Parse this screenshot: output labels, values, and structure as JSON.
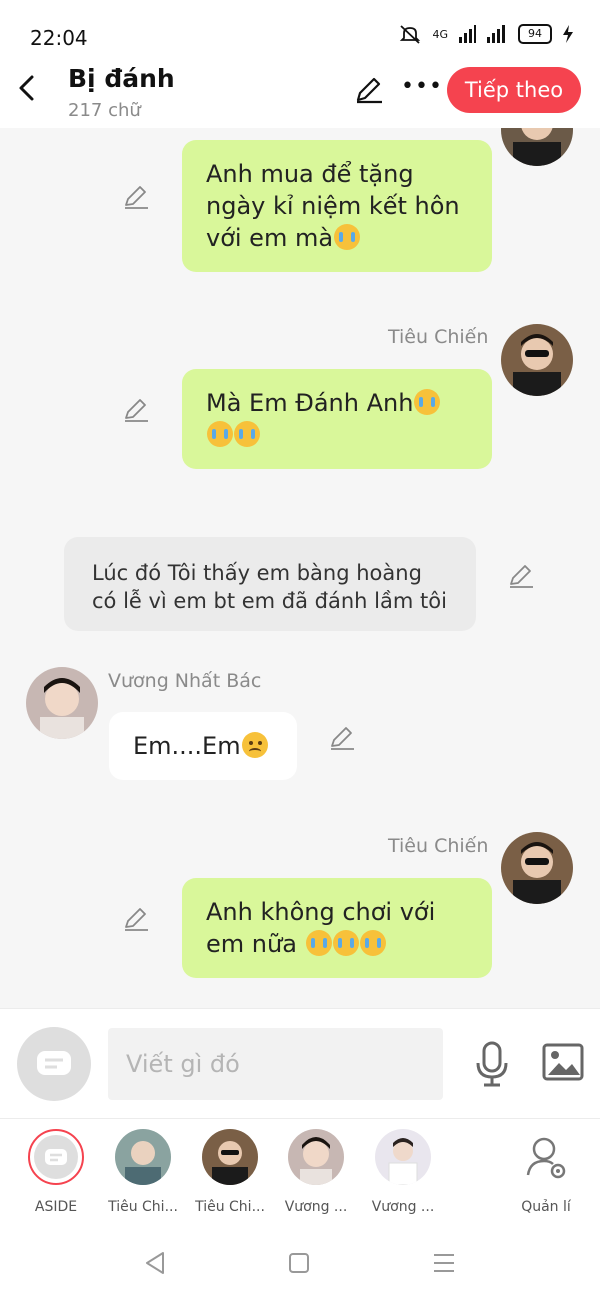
{
  "status": {
    "time": "22:04",
    "network": "4G",
    "battery": "94"
  },
  "header": {
    "title": "Bị đánh",
    "subtitle": "217 chữ",
    "next_label": "Tiếp theo"
  },
  "messages": {
    "m1": {
      "text": "Anh mua để tặng ngày kỉ niệm kết hôn với em mà"
    },
    "m2": {
      "speaker": "Tiêu Chiến",
      "line1": "Mà Em Đánh Anh"
    },
    "narration": {
      "text": "Lúc đó Tôi thấy em bàng hoàng có lễ vì em bt em đã đánh lầm tôi"
    },
    "m3": {
      "speaker": "Vương Nhất Bác",
      "text": "Em....Em"
    },
    "m4": {
      "speaker": "Tiêu Chiến",
      "text": "Anh không chơi với em nữa"
    }
  },
  "input": {
    "placeholder": "Viết gì đó"
  },
  "characters": [
    {
      "label": "ASIDE"
    },
    {
      "label": "Tiêu Chi..."
    },
    {
      "label": "Tiêu Chi..."
    },
    {
      "label": "Vương ..."
    },
    {
      "label": "Vương ..."
    },
    {
      "label": "Quản lí"
    }
  ],
  "colors": {
    "accent": "#f5434f",
    "bubble_green": "#d9f79a",
    "background": "#f6f6f6"
  }
}
